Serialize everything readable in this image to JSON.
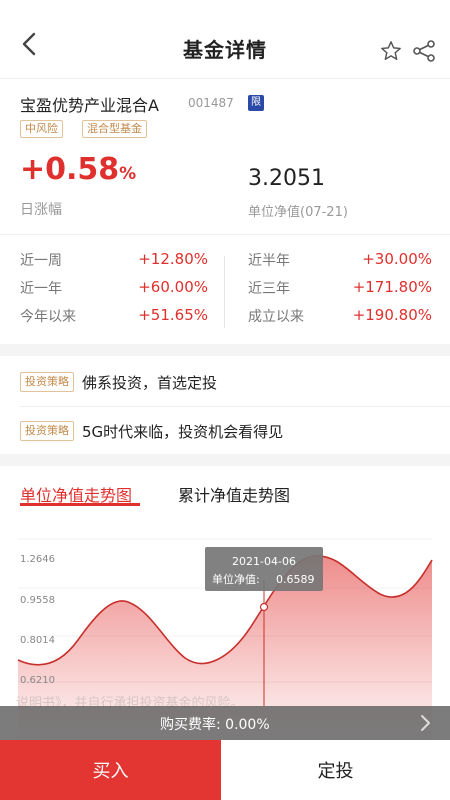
{
  "header": {
    "title": "基金详情",
    "icons": [
      "back-chevron",
      "star-outline",
      "share"
    ]
  },
  "fund": {
    "name": "宝盈优势产业混合A",
    "code": "001487",
    "limit_badge": "限",
    "tags": [
      "中风险",
      "混合型基金"
    ],
    "daily_change": "+0.58",
    "daily_change_unit": "%",
    "daily_change_label": "日涨幅",
    "unit_nav": "3.2051",
    "unit_nav_label": "单位净值(07-21)"
  },
  "performance": {
    "left": [
      {
        "label": "近一周",
        "value": "+12.80%"
      },
      {
        "label": "近一年",
        "value": "+60.00%"
      },
      {
        "label": "今年以来",
        "value": "+51.65%"
      }
    ],
    "right": [
      {
        "label": "近半年",
        "value": "+30.00%"
      },
      {
        "label": "近三年",
        "value": "+171.80%"
      },
      {
        "label": "成立以来",
        "value": "+190.80%"
      }
    ]
  },
  "strategies": [
    {
      "tag": "投资策略",
      "text": "佛系投资，首选定投"
    },
    {
      "tag": "投资策略",
      "text": "5G时代来临，投资机会看得见"
    }
  ],
  "tabs": [
    {
      "label": "单位净值走势图",
      "active": true
    },
    {
      "label": "累计净值走势图",
      "active": false
    }
  ],
  "chart_data": {
    "type": "area",
    "y_ticks": [
      "1.2646",
      "0.9558",
      "0.8014",
      "0.6210"
    ],
    "tooltip": {
      "date": "2021-04-06",
      "label": "单位净值:",
      "value": "0.6589"
    },
    "line_color": "#c8302c"
  },
  "disclaimer": "说明书》，并自行承担投资基金的风险。",
  "fee": {
    "label": "购买费率:",
    "value": "0.00%"
  },
  "actions": {
    "buy": "买入",
    "plan": "定投"
  },
  "colors": {
    "accent": "#e0302d",
    "tag": "#c28a4b",
    "buy_bg": "#e33532"
  }
}
